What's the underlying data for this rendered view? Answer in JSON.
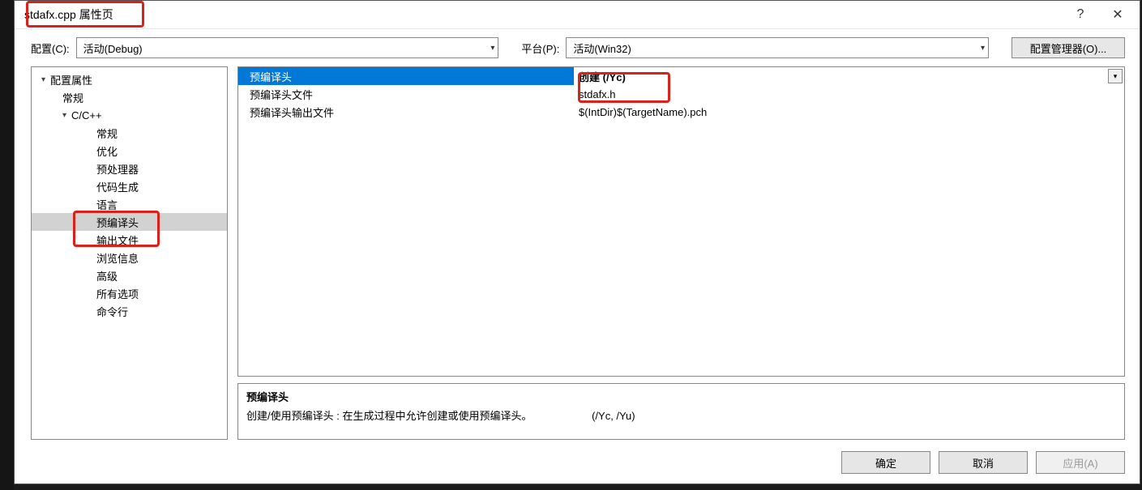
{
  "window": {
    "title": "stdafx.cpp 属性页"
  },
  "titlebar": {
    "help": "?",
    "close": "✕"
  },
  "config_row": {
    "config_label": "配置(C):",
    "config_value": "活动(Debug)",
    "platform_label": "平台(P):",
    "platform_value": "活动(Win32)",
    "config_mgr": "配置管理器(O)..."
  },
  "tree": {
    "root": "配置属性",
    "general": "常规",
    "ccpp": "C/C++",
    "items": [
      "常规",
      "优化",
      "预处理器",
      "代码生成",
      "语言",
      "预编译头",
      "输出文件",
      "浏览信息",
      "高级",
      "所有选项",
      "命令行"
    ]
  },
  "grid": {
    "rows": [
      {
        "label": "预编译头",
        "value": "创建 (/Yc)",
        "bold": true,
        "selected": true,
        "dropdown": true
      },
      {
        "label": "预编译头文件",
        "value": "stdafx.h"
      },
      {
        "label": "预编译头输出文件",
        "value": "$(IntDir)$(TargetName).pch"
      }
    ]
  },
  "info": {
    "title": "预编译头",
    "text": "创建/使用预编译头 : 在生成过程中允许创建或使用预编译头。",
    "flags": "(/Yc, /Yu)"
  },
  "buttons": {
    "ok": "确定",
    "cancel": "取消",
    "apply": "应用(A)"
  }
}
